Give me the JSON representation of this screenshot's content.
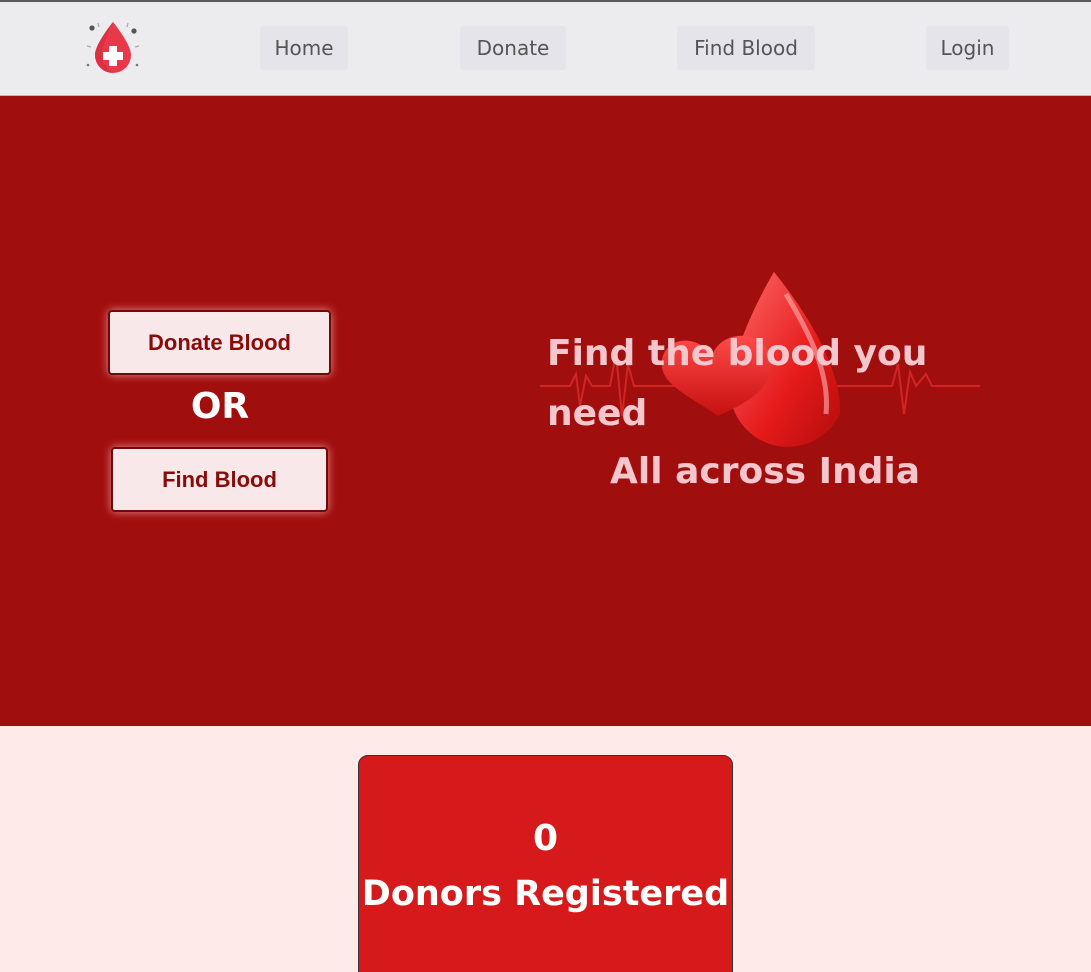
{
  "navbar": {
    "logo_icon": "blood-drop-plus-icon",
    "items": [
      {
        "label": "Home"
      },
      {
        "label": "Donate"
      },
      {
        "label": "Find Blood"
      },
      {
        "label": "Login"
      }
    ]
  },
  "hero": {
    "donate_button": "Donate Blood",
    "or_text": "OR",
    "find_button": "Find Blood",
    "tagline_line1": "Find the blood you need",
    "tagline_line2": "All across India",
    "illustration_icon": "blood-drop-heart-heartbeat-icon"
  },
  "stats": {
    "donor_count": "0",
    "donor_label": "Donors Registered"
  },
  "colors": {
    "nav_bg": "#ececee",
    "hero_bg": "#a10e0e",
    "page_bg": "#ffeaea",
    "card_bg": "#d6191b",
    "button_text": "#8b0b0b",
    "tagline_text": "#f5c6cc"
  }
}
